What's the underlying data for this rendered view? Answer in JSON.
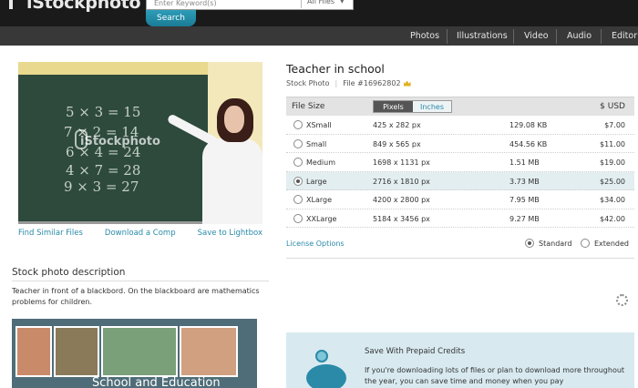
{
  "header": {
    "logo": "iStockphoto",
    "search_placeholder": "Enter Keyword(s)",
    "file_type": "All Files",
    "search_button": "Search"
  },
  "nav": {
    "items": [
      "Photos",
      "Illustrations",
      "Video",
      "Audio",
      "Editor"
    ]
  },
  "photo": {
    "watermark": "iStockphoto",
    "board_lines": [
      "5 × 3 = 15",
      "7 × 2 = 14",
      "6 × 4 = 24",
      "4 × 7 = 28",
      "9 × 3 = 27"
    ],
    "links": [
      "Find Similar Files",
      "Download a Comp",
      "Save to Lightbox"
    ]
  },
  "description": {
    "heading": "Stock photo description",
    "text": "Teacher in front of a blackbord. On the blackboard are mathematics problems for children."
  },
  "banner": {
    "title": "School and Education"
  },
  "file": {
    "title": "Teacher in school",
    "type": "Stock Photo",
    "number": "File #16962802"
  },
  "sizes": {
    "header_label": "File Size",
    "unit_pixels": "Pixels",
    "unit_inches": "Inches",
    "currency": "$ USD",
    "rows": [
      {
        "name": "XSmall",
        "dim": "425 x 282 px",
        "size": "129.08 KB",
        "price": "$7.00",
        "selected": false
      },
      {
        "name": "Small",
        "dim": "849 x 565 px",
        "size": "454.56 KB",
        "price": "$11.00",
        "selected": false
      },
      {
        "name": "Medium",
        "dim": "1698 x 1131 px",
        "size": "1.51 MB",
        "price": "$19.00",
        "selected": false
      },
      {
        "name": "Large",
        "dim": "2716 x 1810 px",
        "size": "3.73 MB",
        "price": "$25.00",
        "selected": true
      },
      {
        "name": "XLarge",
        "dim": "4200 x 2800 px",
        "size": "7.95 MB",
        "price": "$34.00",
        "selected": false
      },
      {
        "name": "XXLarge",
        "dim": "5184 x 3456 px",
        "size": "9.27 MB",
        "price": "$42.00",
        "selected": false
      }
    ]
  },
  "license": {
    "link": "License Options",
    "standard": "Standard",
    "extended": "Extended"
  },
  "credits": {
    "title": "Save With Prepaid Credits",
    "text": "If you're downloading lots of files or plan to download more throughout the year, you can save time and money when you pay"
  },
  "colors": {
    "accent": "#2a8aa8",
    "topbar": "#1a1a1a",
    "navbar": "#383838",
    "selected_row": "#e3eef0"
  }
}
